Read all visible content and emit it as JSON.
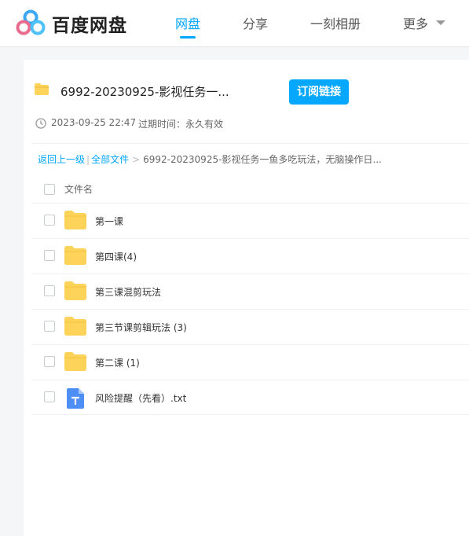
{
  "brand": {
    "name": "百度网盘"
  },
  "nav": {
    "items": [
      {
        "label": "网盘",
        "active": true
      },
      {
        "label": "分享",
        "active": false
      },
      {
        "label": "一刻相册",
        "active": false
      },
      {
        "label": "更多",
        "active": false
      }
    ]
  },
  "share": {
    "folder_title": "6992-20230925-影视任务一...",
    "subscribe_label": "订阅链接",
    "date": "2023-09-25 22:47",
    "expiry_label": "过期时间：永久有效"
  },
  "breadcrumb": {
    "back": "返回上一级",
    "all_files": "全部文件",
    "sep1": "|",
    "sep2": ">",
    "current": "6992-20230925-影视任务一鱼多吃玩法，无脑操作日..."
  },
  "table": {
    "header": "文件名",
    "rows": [
      {
        "name": "第一课",
        "type": "folder"
      },
      {
        "name": "第四课(4)",
        "type": "folder"
      },
      {
        "name": "第三课混剪玩法",
        "type": "folder"
      },
      {
        "name": "第三节课剪辑玩法 (3)",
        "type": "folder"
      },
      {
        "name": "第二课 (1)",
        "type": "folder"
      },
      {
        "name": "风险提醒（先看）.txt",
        "type": "txt"
      }
    ]
  },
  "colors": {
    "accent": "#06a7ff",
    "folder": "#fdd35a",
    "txt": "#4d8ff5"
  }
}
